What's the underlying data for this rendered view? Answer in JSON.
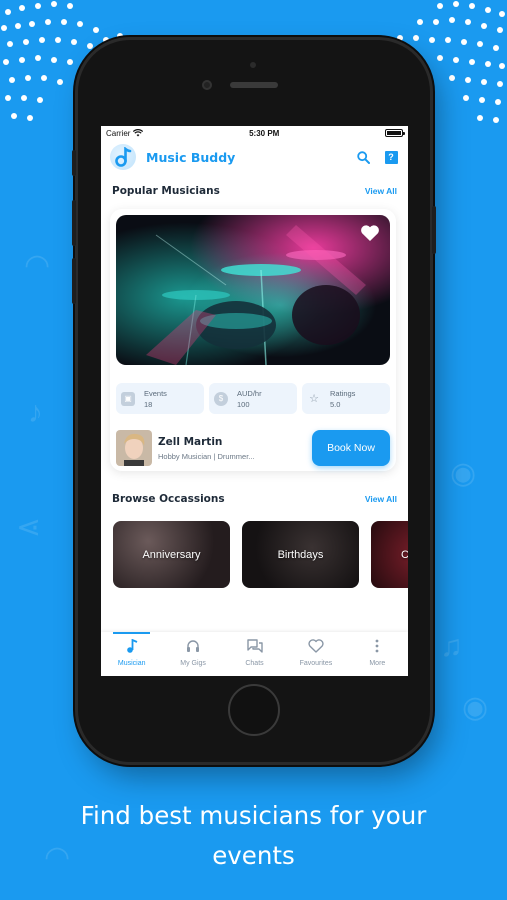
{
  "status_bar": {
    "carrier": "Carrier",
    "time": "5:30 PM"
  },
  "app": {
    "title": "Music Buddy",
    "logo_icon": "music-note-icon"
  },
  "popular": {
    "title": "Popular Musicians",
    "view_all": "View All",
    "card": {
      "stats": [
        {
          "label": "Events",
          "value": "18",
          "icon": "ticket-icon"
        },
        {
          "label": "AUD/hr",
          "value": "100",
          "icon": "dollar-icon"
        },
        {
          "label": "Ratings",
          "value": "5.0",
          "icon": "star-icon"
        }
      ],
      "name": "Zell Martin",
      "role": "Hobby Musician | Drummer...",
      "book_label": "Book Now"
    }
  },
  "browse": {
    "title": "Browse Occassions",
    "view_all": "View All",
    "occasions": [
      "Anniversary",
      "Birthdays",
      "C"
    ]
  },
  "tabs": [
    {
      "label": "Musician",
      "icon": "music-note-icon",
      "active": true
    },
    {
      "label": "My Gigs",
      "icon": "headphones-icon",
      "active": false
    },
    {
      "label": "Chats",
      "icon": "chat-icon",
      "active": false
    },
    {
      "label": "Favourites",
      "icon": "heart-icon",
      "active": false
    },
    {
      "label": "More",
      "icon": "more-vertical-icon",
      "active": false
    }
  ],
  "caption": {
    "line1": "Find best musicians for your",
    "line2": "events"
  },
  "colors": {
    "accent": "#1a9af0",
    "background": "#1a9af0"
  }
}
